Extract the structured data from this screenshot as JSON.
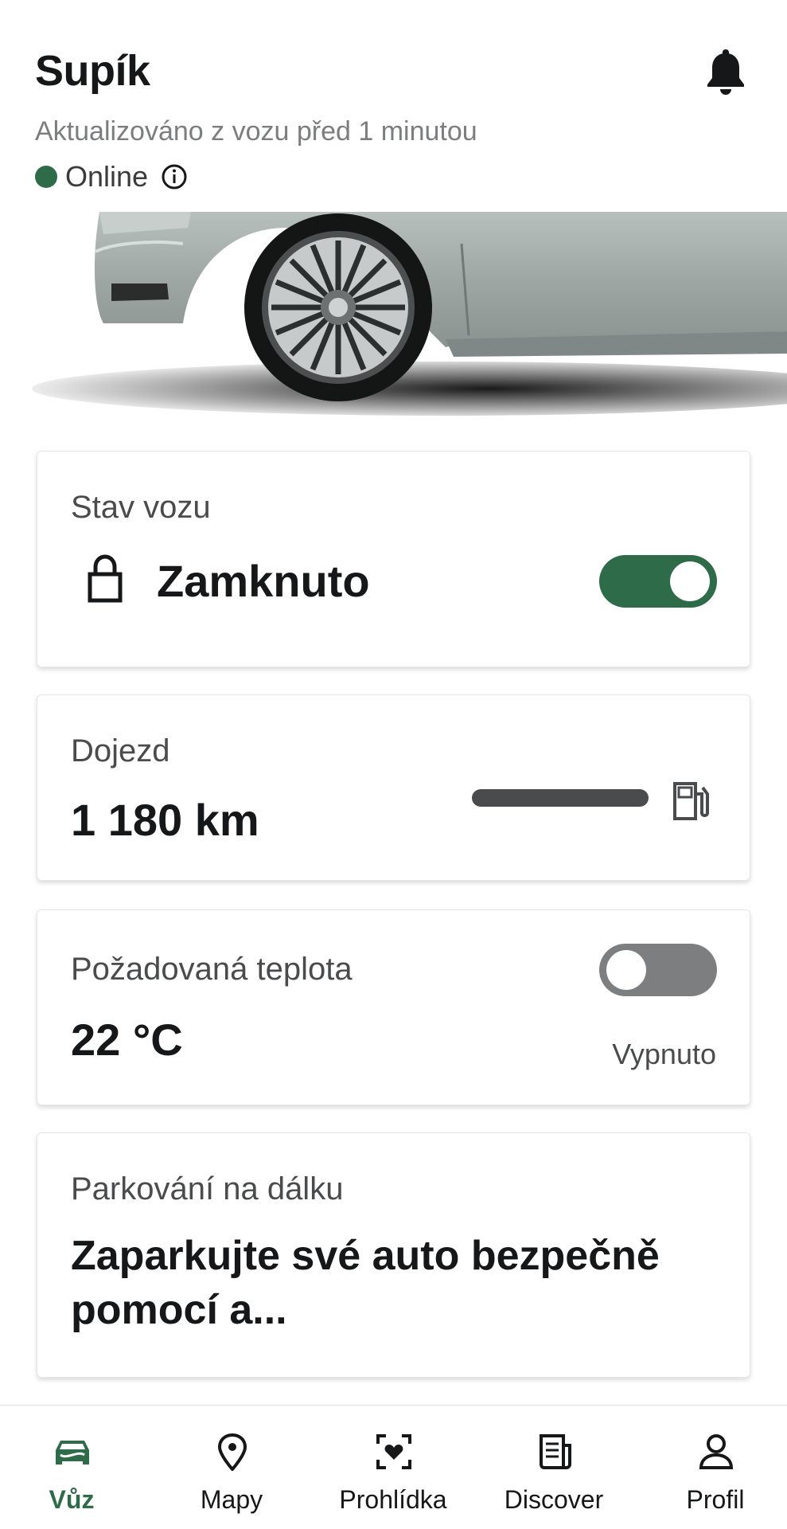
{
  "header": {
    "car_name": "Supík",
    "updated": "Aktualizováno z vozu před 1 minutou",
    "status": "Online",
    "status_color": "#2e6b48"
  },
  "cards": {
    "vehicle_state": {
      "label": "Stav vozu",
      "value": "Zamknuto",
      "toggle_on": true
    },
    "range": {
      "label": "Dojezd",
      "value": "1 180 km",
      "fuel_level_percent": 100
    },
    "temperature": {
      "label": "Požadovaná teplota",
      "value": "22 °C",
      "status": "Vypnuto",
      "toggle_on": false
    },
    "parking": {
      "label": "Parkování na dálku",
      "description": "Zaparkujte své auto bezpečně pomocí a..."
    }
  },
  "bottom_nav": {
    "items": [
      {
        "label": "Vůz",
        "icon": "car-icon",
        "active": true
      },
      {
        "label": "Mapy",
        "icon": "map-pin-icon",
        "active": false
      },
      {
        "label": "Prohlídka",
        "icon": "inspection-icon",
        "active": false
      },
      {
        "label": "Discover",
        "icon": "news-icon",
        "active": false
      },
      {
        "label": "Profil",
        "icon": "profile-icon",
        "active": false
      }
    ]
  },
  "colors": {
    "accent": "#2e6b48",
    "toggle_off": "#7d7e7f",
    "text_primary": "#161718",
    "text_secondary": "#7c7d7e"
  }
}
